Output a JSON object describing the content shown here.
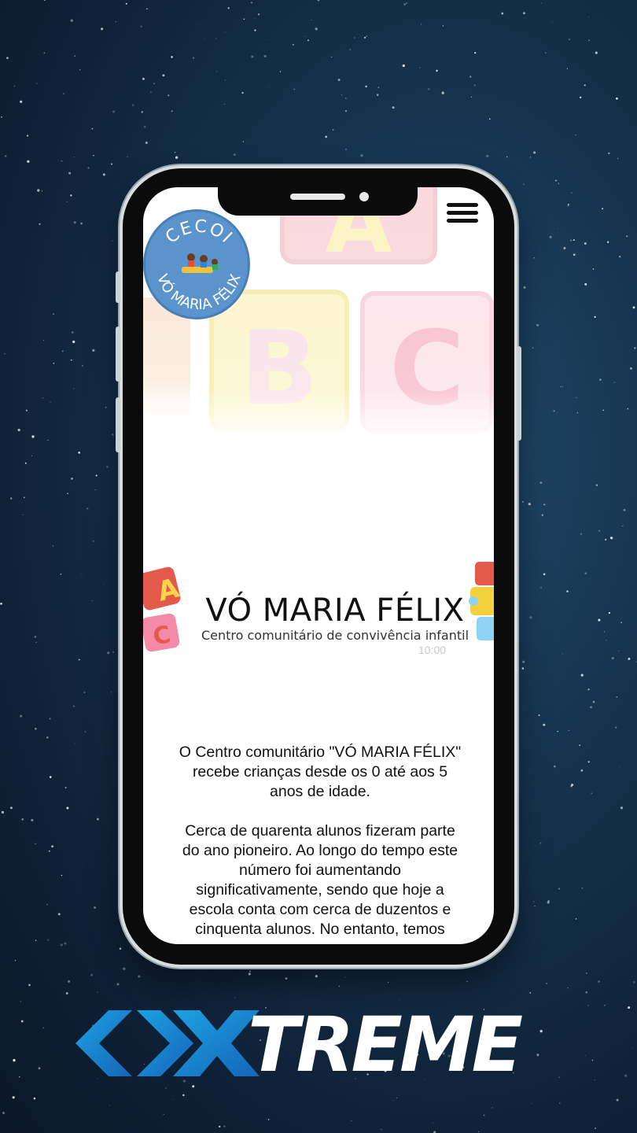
{
  "site": {
    "logo_text_top": "CECOI",
    "logo_text_bottom": "VÓ MARIA FÉLIX",
    "hero_letters": [
      "A",
      "B",
      "C"
    ],
    "brand_title": "VÓ MARIA FÉLIX",
    "brand_subtitle": "Centro comunitário de convivência infantil",
    "brand_time": "10:00",
    "body_paragraphs": [
      "O Centro comunitário \"VÓ MARIA FÉLIX\" recebe crianças desde os 0 até aos 5 anos de idade.",
      "Cerca de quarenta alunos fizeram parte do ano pioneiro. Ao longo do tempo este número foi aumentando significativamente, sendo que hoje a escola conta com cerca de duzentos e cinquenta alunos. No entanto, temos"
    ]
  },
  "watermark": {
    "word": "TREME"
  },
  "colors": {
    "sky": "#12304a",
    "logo_blue": "#5b93cc",
    "accent_cyan": "#1da1e3",
    "accent_blue": "#1565b8"
  },
  "icons": [
    "menu-icon",
    "xtreme-chevron-icon",
    "x-icon"
  ]
}
